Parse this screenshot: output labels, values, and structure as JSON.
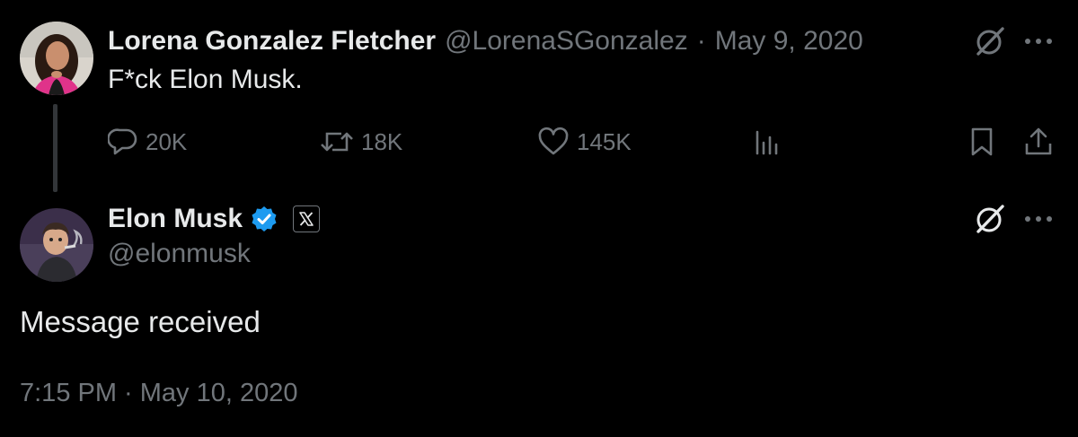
{
  "parent_tweet": {
    "author_name": "Lorena Gonzalez Fletcher",
    "handle": "@LorenaSGonzalez",
    "separator": "·",
    "date": "May 9, 2020",
    "text": "F*ck Elon Musk.",
    "actions": {
      "replies": "20K",
      "reposts": "18K",
      "likes": "145K"
    }
  },
  "main_tweet": {
    "author_name": "Elon Musk",
    "handle": "@elonmusk",
    "text": "Message received",
    "timestamp": "7:15 PM · May 10, 2020"
  },
  "colors": {
    "background": "#000000",
    "text_primary": "#e7e9ea",
    "text_muted": "#71767b",
    "verified_blue": "#1d9bf0",
    "thread_line": "#333639"
  },
  "icons": {
    "parent_avatar": "avatar-photo",
    "main_avatar": "avatar-cartoon",
    "grok": "grok-slash-icon",
    "more": "more-dots-icon",
    "reply": "reply-icon",
    "repost": "repost-icon",
    "like": "heart-icon",
    "views": "views-chart-icon",
    "bookmark": "bookmark-icon",
    "share": "share-icon",
    "verified": "verified-badge-icon",
    "x_logo": "x-logo-icon"
  }
}
